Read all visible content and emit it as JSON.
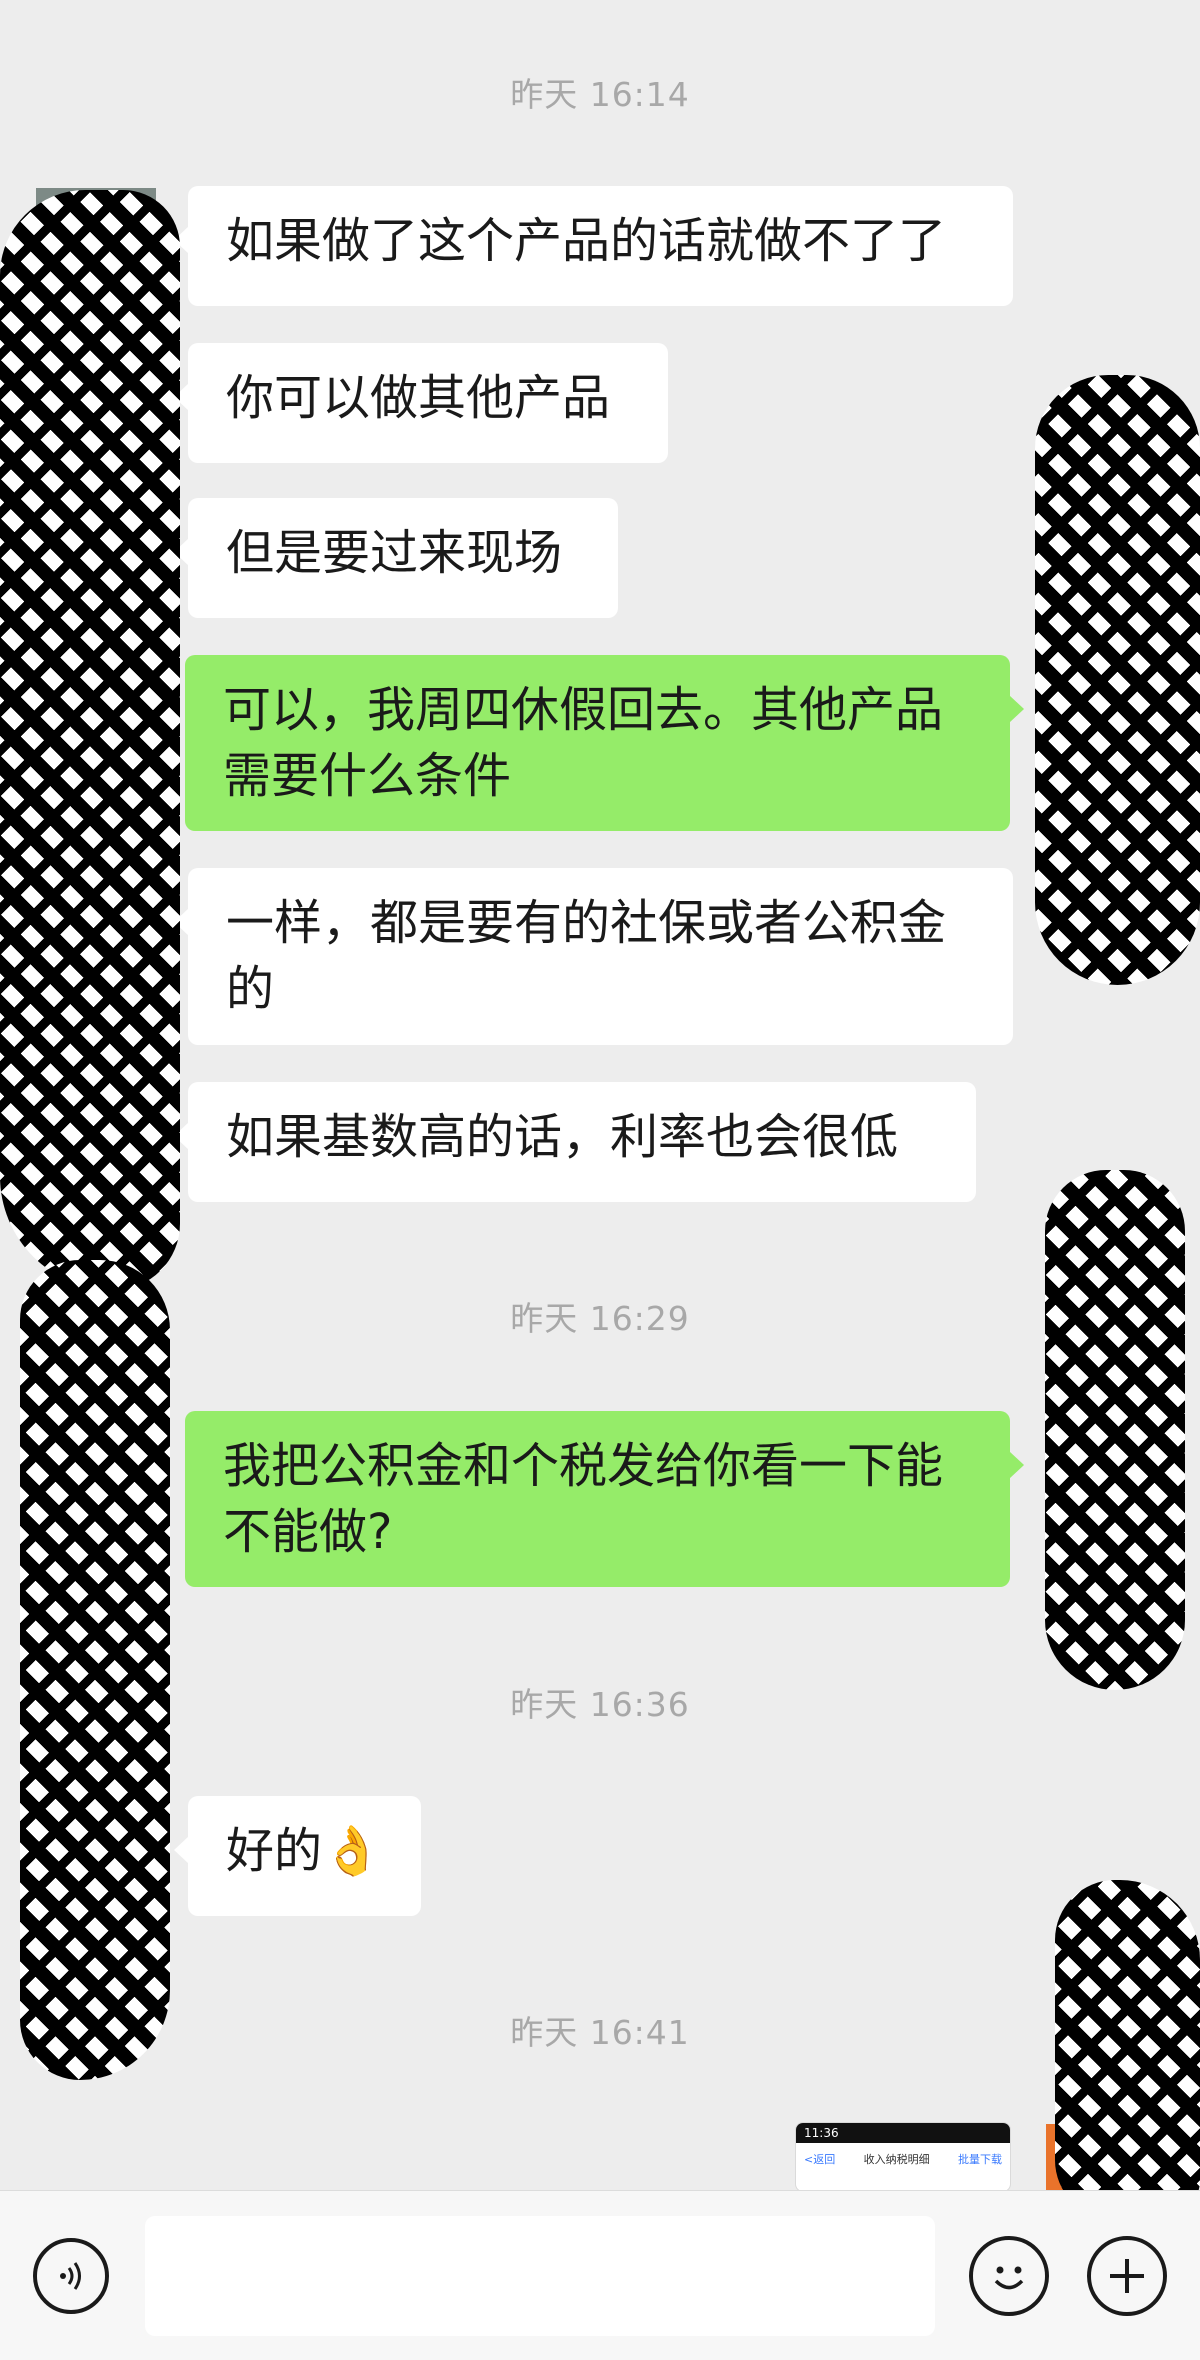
{
  "timestamps": [
    "昨天 16:14",
    "昨天 16:29",
    "昨天 16:36",
    "昨天 16:41"
  ],
  "messages": [
    {
      "from": "contact",
      "text": "如果做了这个产品的话就做不了了"
    },
    {
      "from": "contact",
      "text": "你可以做其他产品"
    },
    {
      "from": "contact",
      "text": "但是要过来现场"
    },
    {
      "from": "me",
      "text": "可以，我周四休假回去。其他产品\n需要什么条件"
    },
    {
      "from": "contact",
      "text": "一样，都是要有的社保或者公积金\n的"
    },
    {
      "from": "contact",
      "text": "如果基数高的话，利率也会很低"
    },
    {
      "from": "me",
      "text": "我把公积金和个税发给你看一下能\n不能做?"
    },
    {
      "from": "contact",
      "text": "好的👌"
    }
  ],
  "image_preview": {
    "status_time": "11:36",
    "back_label": "<返回",
    "title": "收入纳税明细",
    "link": "批量下载"
  },
  "input_bar": {
    "voice_icon": "voice-icon",
    "emoji_icon": "emoji-icon",
    "plus_icon": "plus-icon",
    "input_value": ""
  },
  "colors": {
    "background": "#ededed",
    "incoming_bubble": "#ffffff",
    "outgoing_bubble": "#95ec69",
    "timestamp": "#a8a8a8"
  }
}
